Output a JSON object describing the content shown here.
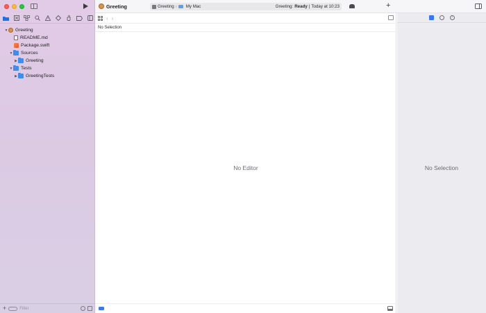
{
  "toolbar": {
    "project_title": "Greeting",
    "activity": {
      "scheme": "Greeting",
      "destination": "My Mac",
      "status_prefix": "Greeting:",
      "status_state": "Ready",
      "status_time": "Today at 10:23"
    }
  },
  "navigator": {
    "tabs": [
      "folder-icon",
      "source-control-icon",
      "symbols-icon",
      "find-icon",
      "issues-icon",
      "tests-icon",
      "debug-icon",
      "breakpoints-icon",
      "reports-icon"
    ],
    "tree": [
      {
        "label": "Greeting",
        "type": "package",
        "expanded": true,
        "level": 0
      },
      {
        "label": "README.md",
        "type": "markdown",
        "level": 1
      },
      {
        "label": "Package.swift",
        "type": "swift",
        "level": 1
      },
      {
        "label": "Sources",
        "type": "folder",
        "expanded": true,
        "level": 1
      },
      {
        "label": "Greeting",
        "type": "folder",
        "expanded": false,
        "level": 2
      },
      {
        "label": "Tests",
        "type": "folder",
        "expanded": true,
        "level": 1
      },
      {
        "label": "GreetingTests",
        "type": "folder",
        "expanded": false,
        "level": 2
      }
    ],
    "filter_placeholder": "Filter"
  },
  "editor": {
    "path_text": "No Selection",
    "empty_text": "No Editor"
  },
  "inspector": {
    "empty_text": "No Selection"
  }
}
